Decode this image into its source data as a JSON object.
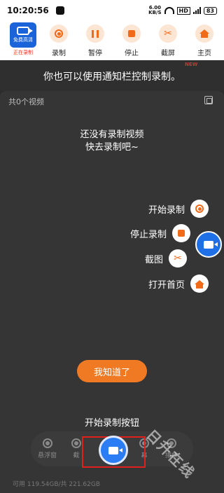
{
  "status_bar": {
    "time": "10:20:56",
    "speed_value": "6.00",
    "speed_unit": "KB/S",
    "hd": "HD",
    "battery": "83"
  },
  "toolbar": {
    "app_label": "免费高清",
    "app_status": "正在录制",
    "tools": [
      {
        "label": "录制",
        "icon": "record-icon"
      },
      {
        "label": "暂停",
        "icon": "pause-icon"
      },
      {
        "label": "停止",
        "icon": "stop-icon"
      },
      {
        "label": "截屏",
        "icon": "scissors-icon"
      },
      {
        "label": "主页",
        "icon": "home-icon"
      }
    ]
  },
  "hint": "你也可以使用通知栏控制录制。",
  "ghost_new": "NEW",
  "list": {
    "count": "共0个视频",
    "empty_line1": "还没有录制视频",
    "empty_line2": "快去录制吧~"
  },
  "guide": [
    {
      "label": "开始录制",
      "icon": "record-icon"
    },
    {
      "label": "停止录制",
      "icon": "stop-icon"
    },
    {
      "label": "截图",
      "icon": "scissors-icon"
    },
    {
      "label": "打开首页",
      "icon": "home-icon"
    }
  ],
  "ok_button": "我知道了",
  "start_button_label": "开始录制按钮",
  "dock": {
    "items": [
      "悬浮窗",
      "截",
      "幕",
      "播放"
    ]
  },
  "storage": "可用 119.54GB/共 221.62GB",
  "watermark": "日升在线",
  "colors": {
    "accent_orange": "#f07a24",
    "accent_blue": "#1f6fe6",
    "highlight_red": "#e0201d"
  }
}
